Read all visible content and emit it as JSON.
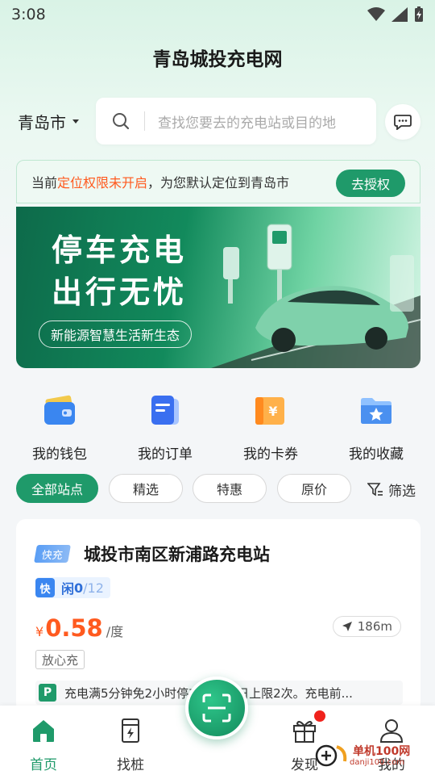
{
  "status_bar": {
    "time": "3:08"
  },
  "app": {
    "title": "青岛城投充电网"
  },
  "search": {
    "city": "青岛市",
    "placeholder": "查找您要去的充电站或目的地"
  },
  "notice": {
    "prefix": "当前",
    "highlight": "定位权限未开启",
    "suffix": "，为您默认定位到青岛市",
    "action": "去授权"
  },
  "banner": {
    "line1": "停车充电",
    "line2": "出行无忧",
    "tag": "新能源智慧生活新生态"
  },
  "quick_actions": [
    {
      "label": "我的钱包",
      "icon": "wallet-icon"
    },
    {
      "label": "我的订单",
      "icon": "order-icon"
    },
    {
      "label": "我的卡券",
      "icon": "coupon-icon"
    },
    {
      "label": "我的收藏",
      "icon": "favorites-folder-icon"
    }
  ],
  "filters": {
    "chips": [
      "全部站点",
      "精选",
      "特惠",
      "原价"
    ],
    "active_index": 0,
    "filter_label": "筛选"
  },
  "station": {
    "type_badge": "快充",
    "name": "城投市南区新浦路充电站",
    "fast_label": "快",
    "idle_prefix": "闲",
    "idle_count": "0",
    "total": "/12",
    "currency": "¥",
    "price": "0.58",
    "unit": "/度",
    "distance": "186m",
    "assured": "放心充",
    "parking_badge": "P",
    "parking_text": "充电满5分钟免2小时停车费，单日上限2次。充电前..."
  },
  "tabbar": {
    "tabs": [
      {
        "label": "首页",
        "icon": "home-icon",
        "active": true
      },
      {
        "label": "找桩",
        "icon": "charging-pile-icon",
        "active": false
      },
      {
        "label": "发现",
        "icon": "gift-icon",
        "active": false
      },
      {
        "label": "我的",
        "icon": "user-icon",
        "active": false
      }
    ],
    "center_icon": "scan-icon"
  },
  "watermark": {
    "text": "单机100网",
    "sub": "danji100.com"
  },
  "colors": {
    "primary": "#1f9a6a",
    "price": "#ff5a1f",
    "highlight": "#ff5a1f",
    "badge_blue": "#3a86f0"
  }
}
